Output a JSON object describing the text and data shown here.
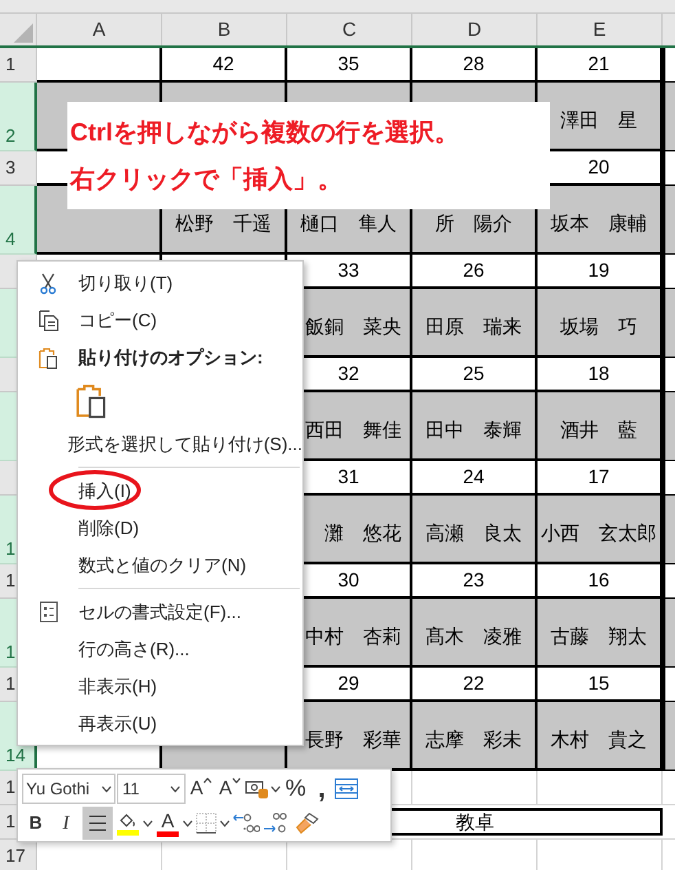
{
  "columns": [
    {
      "label": "A"
    },
    {
      "label": "B"
    },
    {
      "label": "C"
    },
    {
      "label": "D"
    },
    {
      "label": "E"
    }
  ],
  "rows": [
    {
      "header": "1",
      "selected": false,
      "kind": "number",
      "cells": [
        {
          "shaded": false
        },
        {
          "text": "42",
          "shaded": false
        },
        {
          "text": "35",
          "shaded": false
        },
        {
          "text": "28",
          "shaded": false
        },
        {
          "text": "21",
          "shaded": false
        }
      ]
    },
    {
      "header": "2",
      "selected": true,
      "kind": "name",
      "cells": [
        {
          "shaded": true
        },
        {
          "shaded": true
        },
        {
          "shaded": true
        },
        {
          "shaded": true
        },
        {
          "text": "澤田　星",
          "shaded": true
        }
      ]
    },
    {
      "header": "3",
      "selected": false,
      "kind": "number",
      "cells": [
        {
          "shaded": false
        },
        {},
        {},
        {},
        {
          "text": "20",
          "shaded": false
        }
      ]
    },
    {
      "header": "4",
      "selected": true,
      "kind": "name",
      "cells": [
        {
          "shaded": true
        },
        {
          "text": "松野　千遥",
          "shaded": true
        },
        {
          "text": "樋口　隼人",
          "shaded": true
        },
        {
          "text": "所　陽介",
          "shaded": true
        },
        {
          "text": "坂本　康輔",
          "shaded": true
        }
      ]
    },
    {
      "selected": false,
      "kind": "number",
      "cells": [
        {},
        {},
        {
          "text": "33",
          "shaded": false
        },
        {
          "text": "26",
          "shaded": false
        },
        {
          "text": "19",
          "shaded": false
        }
      ]
    },
    {
      "selected": true,
      "kind": "name",
      "cells": [
        {},
        {},
        {
          "text": "飯銅　菜央",
          "shaded": true
        },
        {
          "text": "田原　瑞来",
          "shaded": true
        },
        {
          "text": "坂場　巧",
          "shaded": true
        }
      ]
    },
    {
      "selected": false,
      "kind": "number",
      "cells": [
        {},
        {},
        {
          "text": "32",
          "shaded": false
        },
        {
          "text": "25",
          "shaded": false
        },
        {
          "text": "18",
          "shaded": false
        }
      ]
    },
    {
      "selected": true,
      "kind": "name",
      "cells": [
        {},
        {},
        {
          "text": "西田　舞佳",
          "shaded": true
        },
        {
          "text": "田中　泰輝",
          "shaded": true
        },
        {
          "text": "酒井　藍",
          "shaded": true
        }
      ]
    },
    {
      "selected": false,
      "kind": "number",
      "cells": [
        {},
        {},
        {
          "text": "31",
          "shaded": false
        },
        {
          "text": "24",
          "shaded": false
        },
        {
          "text": "17",
          "shaded": false
        }
      ]
    },
    {
      "header": "1",
      "selected": true,
      "kind": "name",
      "cells": [
        {},
        {},
        {
          "text": "灘　悠花",
          "shaded": true
        },
        {
          "text": "高瀬　良太",
          "shaded": true
        },
        {
          "text": "小西　玄太郎",
          "shaded": true
        }
      ]
    },
    {
      "header": "1",
      "selected": false,
      "kind": "number",
      "cells": [
        {},
        {},
        {
          "text": "30",
          "shaded": false
        },
        {
          "text": "23",
          "shaded": false
        },
        {
          "text": "16",
          "shaded": false
        }
      ]
    },
    {
      "header": "1",
      "selected": true,
      "kind": "name",
      "cells": [
        {},
        {},
        {
          "text": "中村　杏莉",
          "shaded": true
        },
        {
          "text": "髙木　凌雅",
          "shaded": true
        },
        {
          "text": "古藤　翔太",
          "shaded": true
        }
      ]
    },
    {
      "header": "1",
      "selected": false,
      "kind": "number",
      "cells": [
        {},
        {},
        {
          "text": "29",
          "shaded": false
        },
        {
          "text": "22",
          "shaded": false
        },
        {
          "text": "15",
          "shaded": false
        }
      ]
    },
    {
      "header": "14",
      "selected": true,
      "kind": "name",
      "cells": [
        {
          "shaded": false
        },
        {
          "shaded": true
        },
        {
          "text": "長野　彩華",
          "shaded": true
        },
        {
          "text": "志摩　彩未",
          "shaded": true
        },
        {
          "text": "木村　貴之",
          "shaded": true
        }
      ]
    },
    {
      "header": "1",
      "selected": false,
      "kind": "blank",
      "cells": [
        {},
        {},
        {
          "shaded": false
        },
        {
          "shaded": false
        },
        {
          "shaded": false
        }
      ]
    },
    {
      "header": "1",
      "selected": false,
      "kind": "desk",
      "cells": [
        {},
        {},
        {
          "text": "教卓",
          "merged": true
        }
      ]
    },
    {
      "header": "17",
      "selected": false,
      "kind": "blank",
      "cells": [
        {
          "shaded": false
        },
        {
          "shaded": false
        },
        {
          "shaded": false
        },
        {
          "shaded": false
        },
        {
          "shaded": false
        }
      ]
    }
  ],
  "callout": {
    "lines": [
      "Ctrlを押しながら複数の行を選択。",
      "右クリックで「挿入」。"
    ]
  },
  "context_menu": {
    "items": [
      {
        "kind": "cut",
        "label": "切り取り(T)"
      },
      {
        "kind": "copy",
        "label": "コピー(C)"
      },
      {
        "kind": "paste-header",
        "label": "貼り付けのオプション:"
      },
      {
        "kind": "paste-option"
      },
      {
        "kind": "command",
        "label": "形式を選択して貼り付け(S)..."
      },
      {
        "kind": "separator"
      },
      {
        "kind": "command",
        "label": "挿入(I)",
        "circled": true
      },
      {
        "kind": "command",
        "label": "削除(D)"
      },
      {
        "kind": "command",
        "label": "数式と値のクリア(N)"
      },
      {
        "kind": "separator"
      },
      {
        "kind": "format-cells",
        "label": "セルの書式設定(F)..."
      },
      {
        "kind": "command",
        "label": "行の高さ(R)..."
      },
      {
        "kind": "command",
        "label": "非表示(H)"
      },
      {
        "kind": "command",
        "label": "再表示(U)"
      }
    ]
  },
  "mini_toolbar": {
    "font": "Yu Gothi",
    "size": "11",
    "grow": "A",
    "shrink": "A",
    "percent": "%",
    "comma": ",",
    "bold": "B",
    "italic": "I",
    "align": {
      "selected": true
    },
    "font_color_label": "A"
  }
}
